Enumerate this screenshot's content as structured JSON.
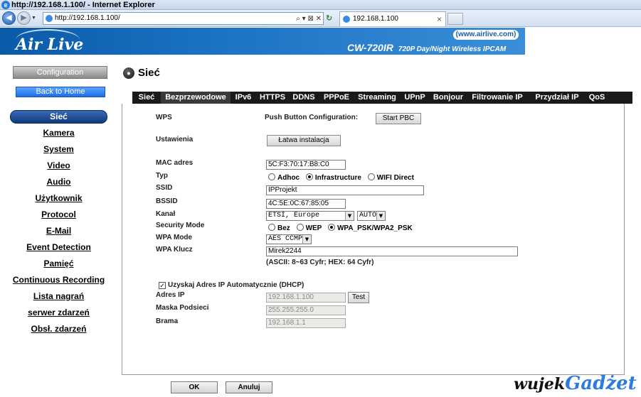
{
  "window": {
    "title": "http://192.168.1.100/ - Internet Explorer",
    "address": "http://192.168.1.100/",
    "tab_title": "192.168.1.100",
    "search_tools": "⌕ ▾ ⊠ ✕"
  },
  "banner": {
    "logo": "Air Live",
    "site": "(www.airlive.com)",
    "model": "CW-720IR",
    "model_desc": "720P Day/Night Wireless IPCAM",
    "colors": {
      "top": "#0a5aa8",
      "bottom": "#3b8fd8"
    }
  },
  "sidebar": {
    "config_label": "Configuration",
    "back_label": "Back to Home",
    "selected": "Sieć",
    "items": [
      "Kamera",
      "System",
      "Video",
      "Audio",
      "Użytkownik",
      "Protocol",
      "E-Mail",
      "Event Detection",
      "Pamięć",
      "Continuous Recording",
      "Lista nagrań",
      "serwer zdarzeń",
      "Obsł. zdarzeń"
    ]
  },
  "page": {
    "title": "Sieć"
  },
  "tabs": [
    "Sieć",
    "Bezprzewodowe",
    "IPv6",
    "HTTPS",
    "DDNS",
    "PPPoE",
    "Streaming",
    "UPnP",
    "Bonjour",
    "Filtrowanie IP",
    "Przydział IP",
    "QoS"
  ],
  "active_tab": "Bezprzewodowe",
  "form": {
    "wps_label": "WPS",
    "pbc_label": "Push Button Configuration:",
    "start_pbc": "Start PBC",
    "settings_label": "Ustawienia",
    "easy_setup": "Łatwa instalacja",
    "mac_label": "MAC adres",
    "mac_value": "5C:F3:70:17:B8:C0",
    "type_label": "Typ",
    "type_options": [
      "Adhoc",
      "Infrastructure",
      "WIFI Direct"
    ],
    "type_selected": "Infrastructure",
    "ssid_label": "SSID",
    "ssid_value": "IPProjekt",
    "bssid_label": "BSSID",
    "bssid_value": "4C:5E:0C:67:85:05",
    "channel_label": "Kanał",
    "channel_region": "ETSI, Europe",
    "channel_value": "AUTO",
    "security_label": "Security Mode",
    "security_options": [
      "Bez",
      "WEP",
      "WPA_PSK/WPA2_PSK"
    ],
    "security_selected": "WPA_PSK/WPA2_PSK",
    "wpa_mode_label": "WPA Mode",
    "wpa_mode_value": "AES CCMP",
    "wpa_key_label": "WPA Klucz",
    "wpa_key_value": "Mirek2244",
    "key_hint": "(ASCII: 8~63 Cyfr; HEX: 64 Cyfr)",
    "dhcp_label": "Uzyskaj Adres IP Automatycznie (DHCP)",
    "dhcp_checked": "✓",
    "ip_label": "Adres IP",
    "ip_value": "192.168.1.100",
    "test_label": "Test",
    "mask_label": "Maska Podsieci",
    "mask_value": "255.255.255.0",
    "gateway_label": "Brama",
    "gateway_value": "192.168.1.1"
  },
  "buttons": {
    "ok": "OK",
    "cancel": "Anuluj"
  },
  "watermark": {
    "left": "wujek",
    "right": "Gadżet"
  }
}
